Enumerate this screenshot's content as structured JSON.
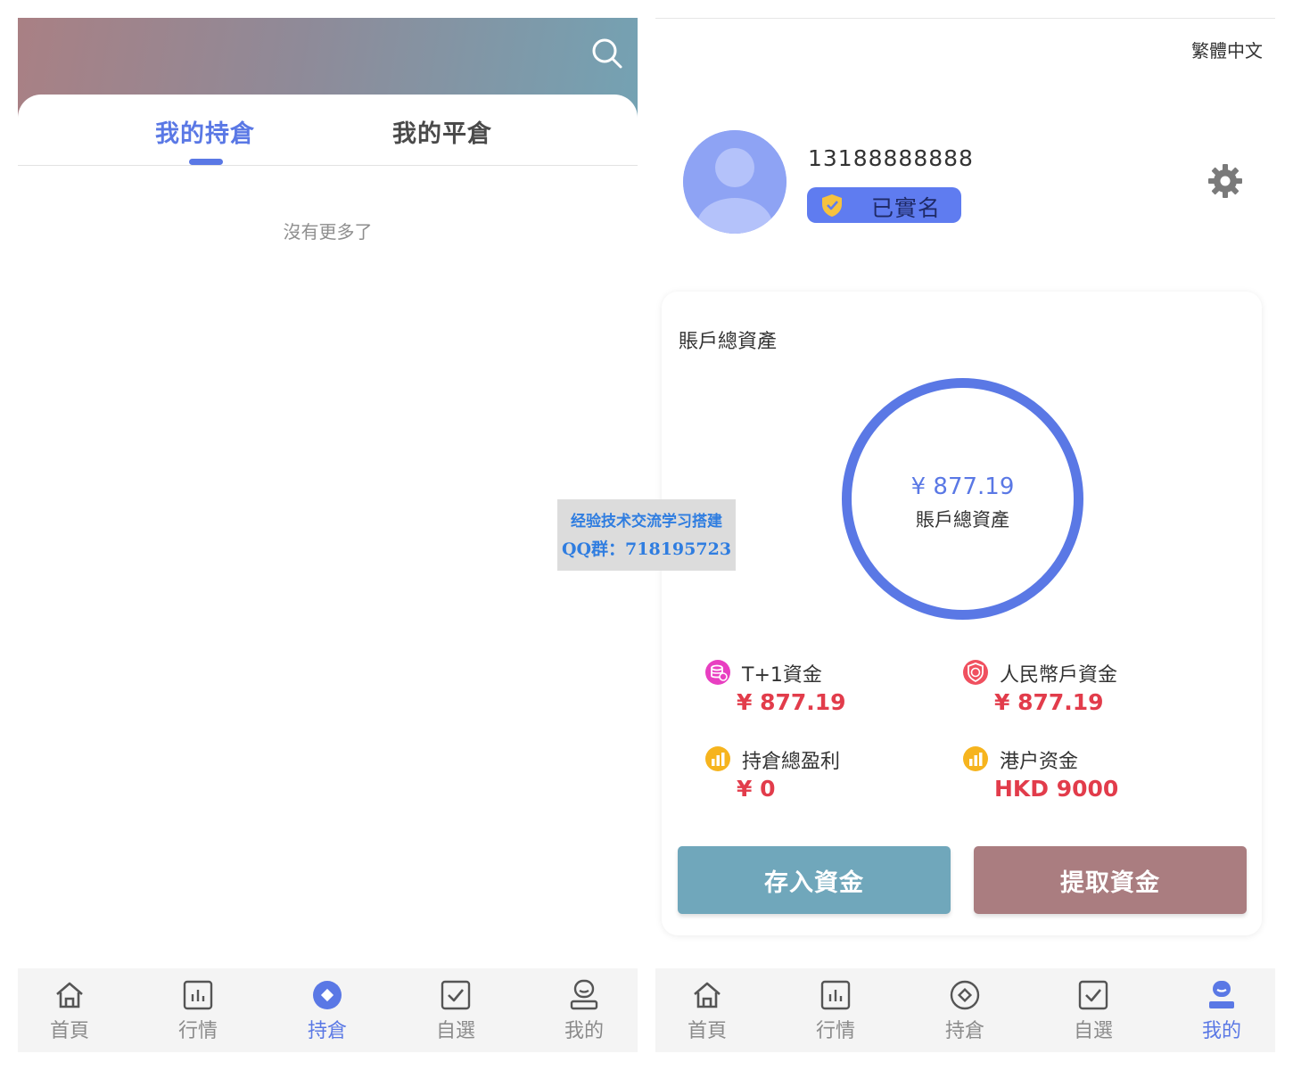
{
  "left": {
    "search_icon": "search-icon",
    "tabs": [
      {
        "label": "我的持倉",
        "active": true
      },
      {
        "label": "我的平倉",
        "active": false
      }
    ],
    "empty_text": "沒有更多了"
  },
  "right": {
    "language": "繁體中文",
    "user": {
      "phone": "13188888888",
      "verified_label": "已實名"
    },
    "asset_card": {
      "title": "賬戶總資產",
      "ring_value": "¥ 877.19",
      "ring_label": "賬戶總資產",
      "stats": [
        {
          "label": "T+1資金",
          "value": "¥ 877.19",
          "icon": "coin-stack-icon"
        },
        {
          "label": "人民幣戶資金",
          "value": "¥ 877.19",
          "icon": "rmb-badge-icon"
        },
        {
          "label": "持倉總盈利",
          "value": "¥ 0",
          "icon": "chart-coin-icon"
        },
        {
          "label": "港户资金",
          "value": "HKD 9000",
          "icon": "chart-coin-icon"
        }
      ],
      "deposit_label": "存入資金",
      "withdraw_label": "提取資金"
    }
  },
  "nav": {
    "items": [
      {
        "label": "首頁",
        "icon": "home-icon"
      },
      {
        "label": "行情",
        "icon": "market-chart-icon"
      },
      {
        "label": "持倉",
        "icon": "position-icon"
      },
      {
        "label": "自選",
        "icon": "watchlist-icon"
      },
      {
        "label": "我的",
        "icon": "profile-icon"
      }
    ]
  },
  "watermark": {
    "line1": "经验技术交流学习搭建",
    "line2": "QQ群：718195723"
  },
  "colors": {
    "accent": "#5a78e5",
    "profit_red": "#e23c4b",
    "deposit_button": "#70a7bb",
    "withdraw_button": "#aa7d80",
    "verified_badge": "#5f7cf0"
  }
}
